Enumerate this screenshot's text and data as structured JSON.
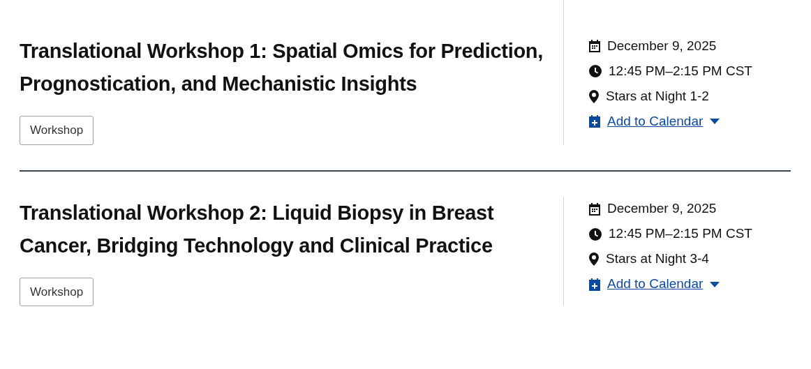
{
  "sessions": [
    {
      "title": "Translational Workshop 1: Spatial Omics for Prediction, Prognostication, and Mechanistic Insights",
      "tag": "Workshop",
      "date": "December 9, 2025",
      "time": "12:45 PM–2:15 PM CST",
      "location": "Stars at Night 1-2",
      "calendar_link": "Add to Calendar"
    },
    {
      "title": "Translational Workshop 2: Liquid Biopsy in Breast Cancer, Bridging Technology and Clinical Practice",
      "tag": "Workshop",
      "date": "December 9, 2025",
      "time": "12:45 PM–2:15 PM CST",
      "location": "Stars at Night 3-4",
      "calendar_link": "Add to Calendar"
    }
  ]
}
